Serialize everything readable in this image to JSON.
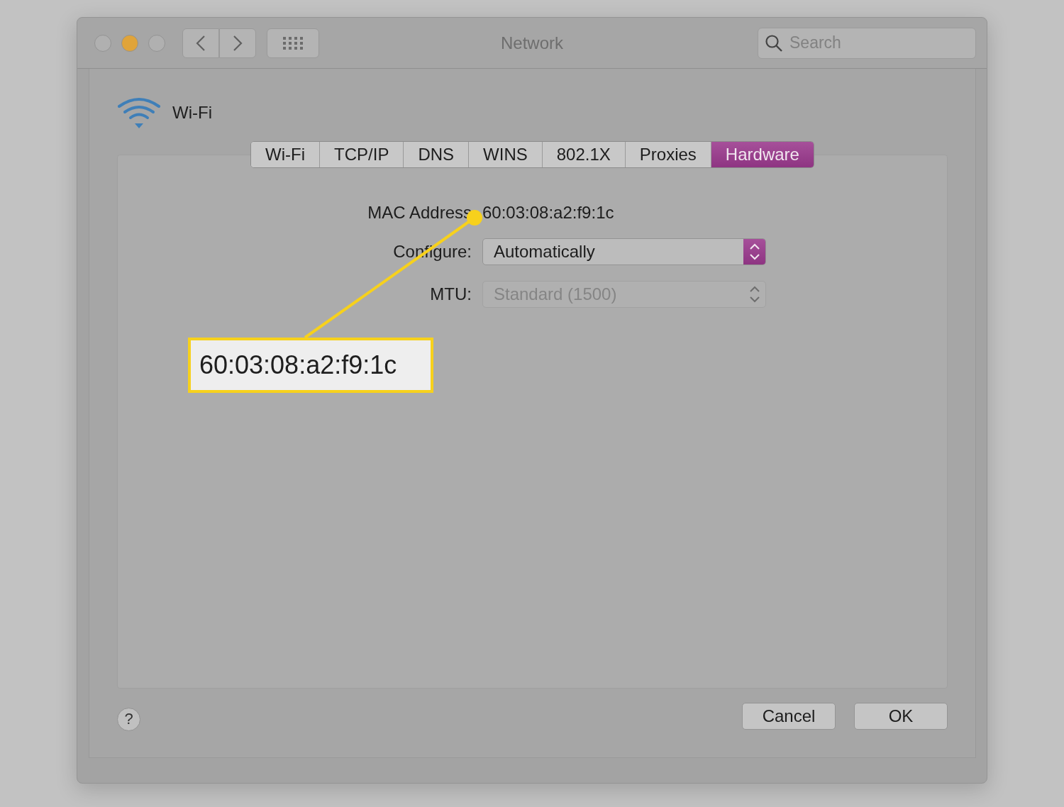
{
  "window": {
    "title": "Network"
  },
  "search": {
    "placeholder": "Search"
  },
  "interface": {
    "name": "Wi-Fi"
  },
  "tabs": [
    {
      "label": "Wi-Fi",
      "selected": false
    },
    {
      "label": "TCP/IP",
      "selected": false
    },
    {
      "label": "DNS",
      "selected": false
    },
    {
      "label": "WINS",
      "selected": false
    },
    {
      "label": "802.1X",
      "selected": false
    },
    {
      "label": "Proxies",
      "selected": false
    },
    {
      "label": "Hardware",
      "selected": true
    }
  ],
  "fields": [
    {
      "kind": "text",
      "label": "MAC Address",
      "value": "60:03:08:a2:f9:1c"
    },
    {
      "kind": "popup",
      "label": "Configure:",
      "value": "Automatically",
      "disabled": false
    },
    {
      "kind": "popup",
      "label": "MTU:",
      "value": "Standard  (1500)",
      "disabled": true
    }
  ],
  "callout": {
    "text": "60:03:08:a2:f9:1c"
  },
  "help": {
    "label": "?"
  },
  "buttons": [
    "Cancel",
    "OK"
  ]
}
